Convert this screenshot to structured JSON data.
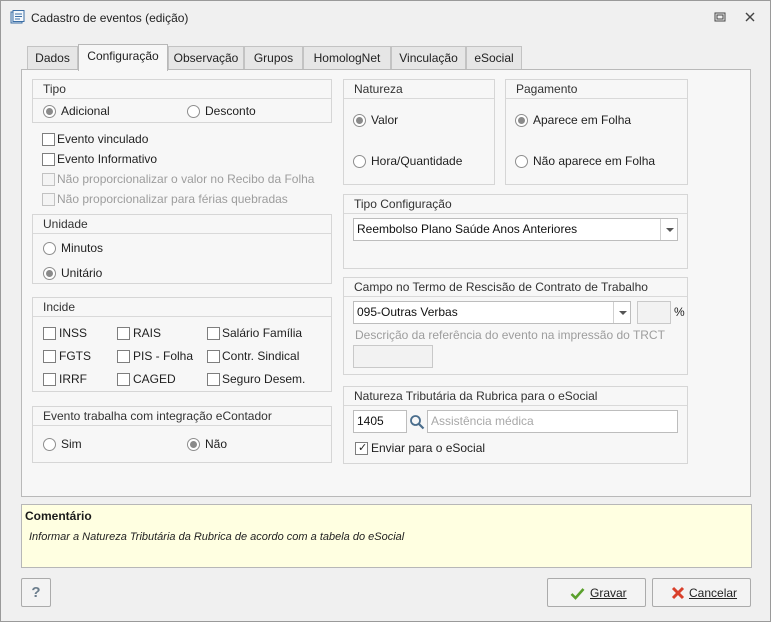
{
  "window": {
    "title": "Cadastro de eventos (edição)"
  },
  "tabs": [
    "Dados",
    "Configuração",
    "Observação",
    "Grupos",
    "HomologNet",
    "Vinculação",
    "eSocial"
  ],
  "tipo": {
    "title": "Tipo",
    "options": [
      "Adicional",
      "Desconto"
    ],
    "selected": "Adicional"
  },
  "flags": {
    "evento_vinculado": "Evento vinculado",
    "evento_informativo": "Evento Informativo",
    "nao_prop_recibo": "Não proporcionalizar o valor no Recibo da Folha",
    "nao_prop_ferias": "Não proporcionalizar para férias quebradas"
  },
  "unidade": {
    "title": "Unidade",
    "options": [
      "Minutos",
      "Unitário"
    ],
    "selected": "Unitário"
  },
  "incide": {
    "title": "Incide",
    "items": [
      "INSS",
      "RAIS",
      "Salário Família",
      "FGTS",
      "PIS - Folha",
      "Contr. Sindical",
      "IRRF",
      "CAGED",
      "Seguro Desem."
    ]
  },
  "econtador": {
    "title": "Evento trabalha com integração eContador",
    "options": [
      "Sim",
      "Não"
    ],
    "selected": "Não"
  },
  "natureza": {
    "title": "Natureza",
    "options": [
      "Valor",
      "Hora/Quantidade"
    ],
    "selected": "Valor"
  },
  "pagamento": {
    "title": "Pagamento",
    "options": [
      "Aparece em Folha",
      "Não aparece em Folha"
    ],
    "selected": "Aparece em Folha"
  },
  "tipo_config": {
    "title": "Tipo Configuração",
    "value": "Reembolso Plano Saúde Anos Anteriores"
  },
  "rescisao": {
    "title": "Campo no Termo de Rescisão de Contrato de Trabalho",
    "value": "095-Outras Verbas",
    "percent_value": "",
    "percent_symbol": "%",
    "desc_label": "Descrição da referência do evento na impressão do TRCT",
    "desc_value": ""
  },
  "natureza_trib": {
    "title": "Natureza Tributária da Rubrica para o eSocial",
    "code": "1405",
    "description": "Assistência médica",
    "enviar_label": "Enviar para o eSocial",
    "enviar_checked": true
  },
  "comment": {
    "title": "Comentário",
    "text": "Informar a Natureza Tributária da Rubrica de acordo com a tabela do eSocial"
  },
  "buttons": {
    "help": "?",
    "gravar": "Gravar",
    "cancelar": "Cancelar"
  },
  "colors": {
    "comment_bg": "#ffffe1",
    "ok_green": "#5aa02c",
    "cancel_red": "#d9402b"
  }
}
